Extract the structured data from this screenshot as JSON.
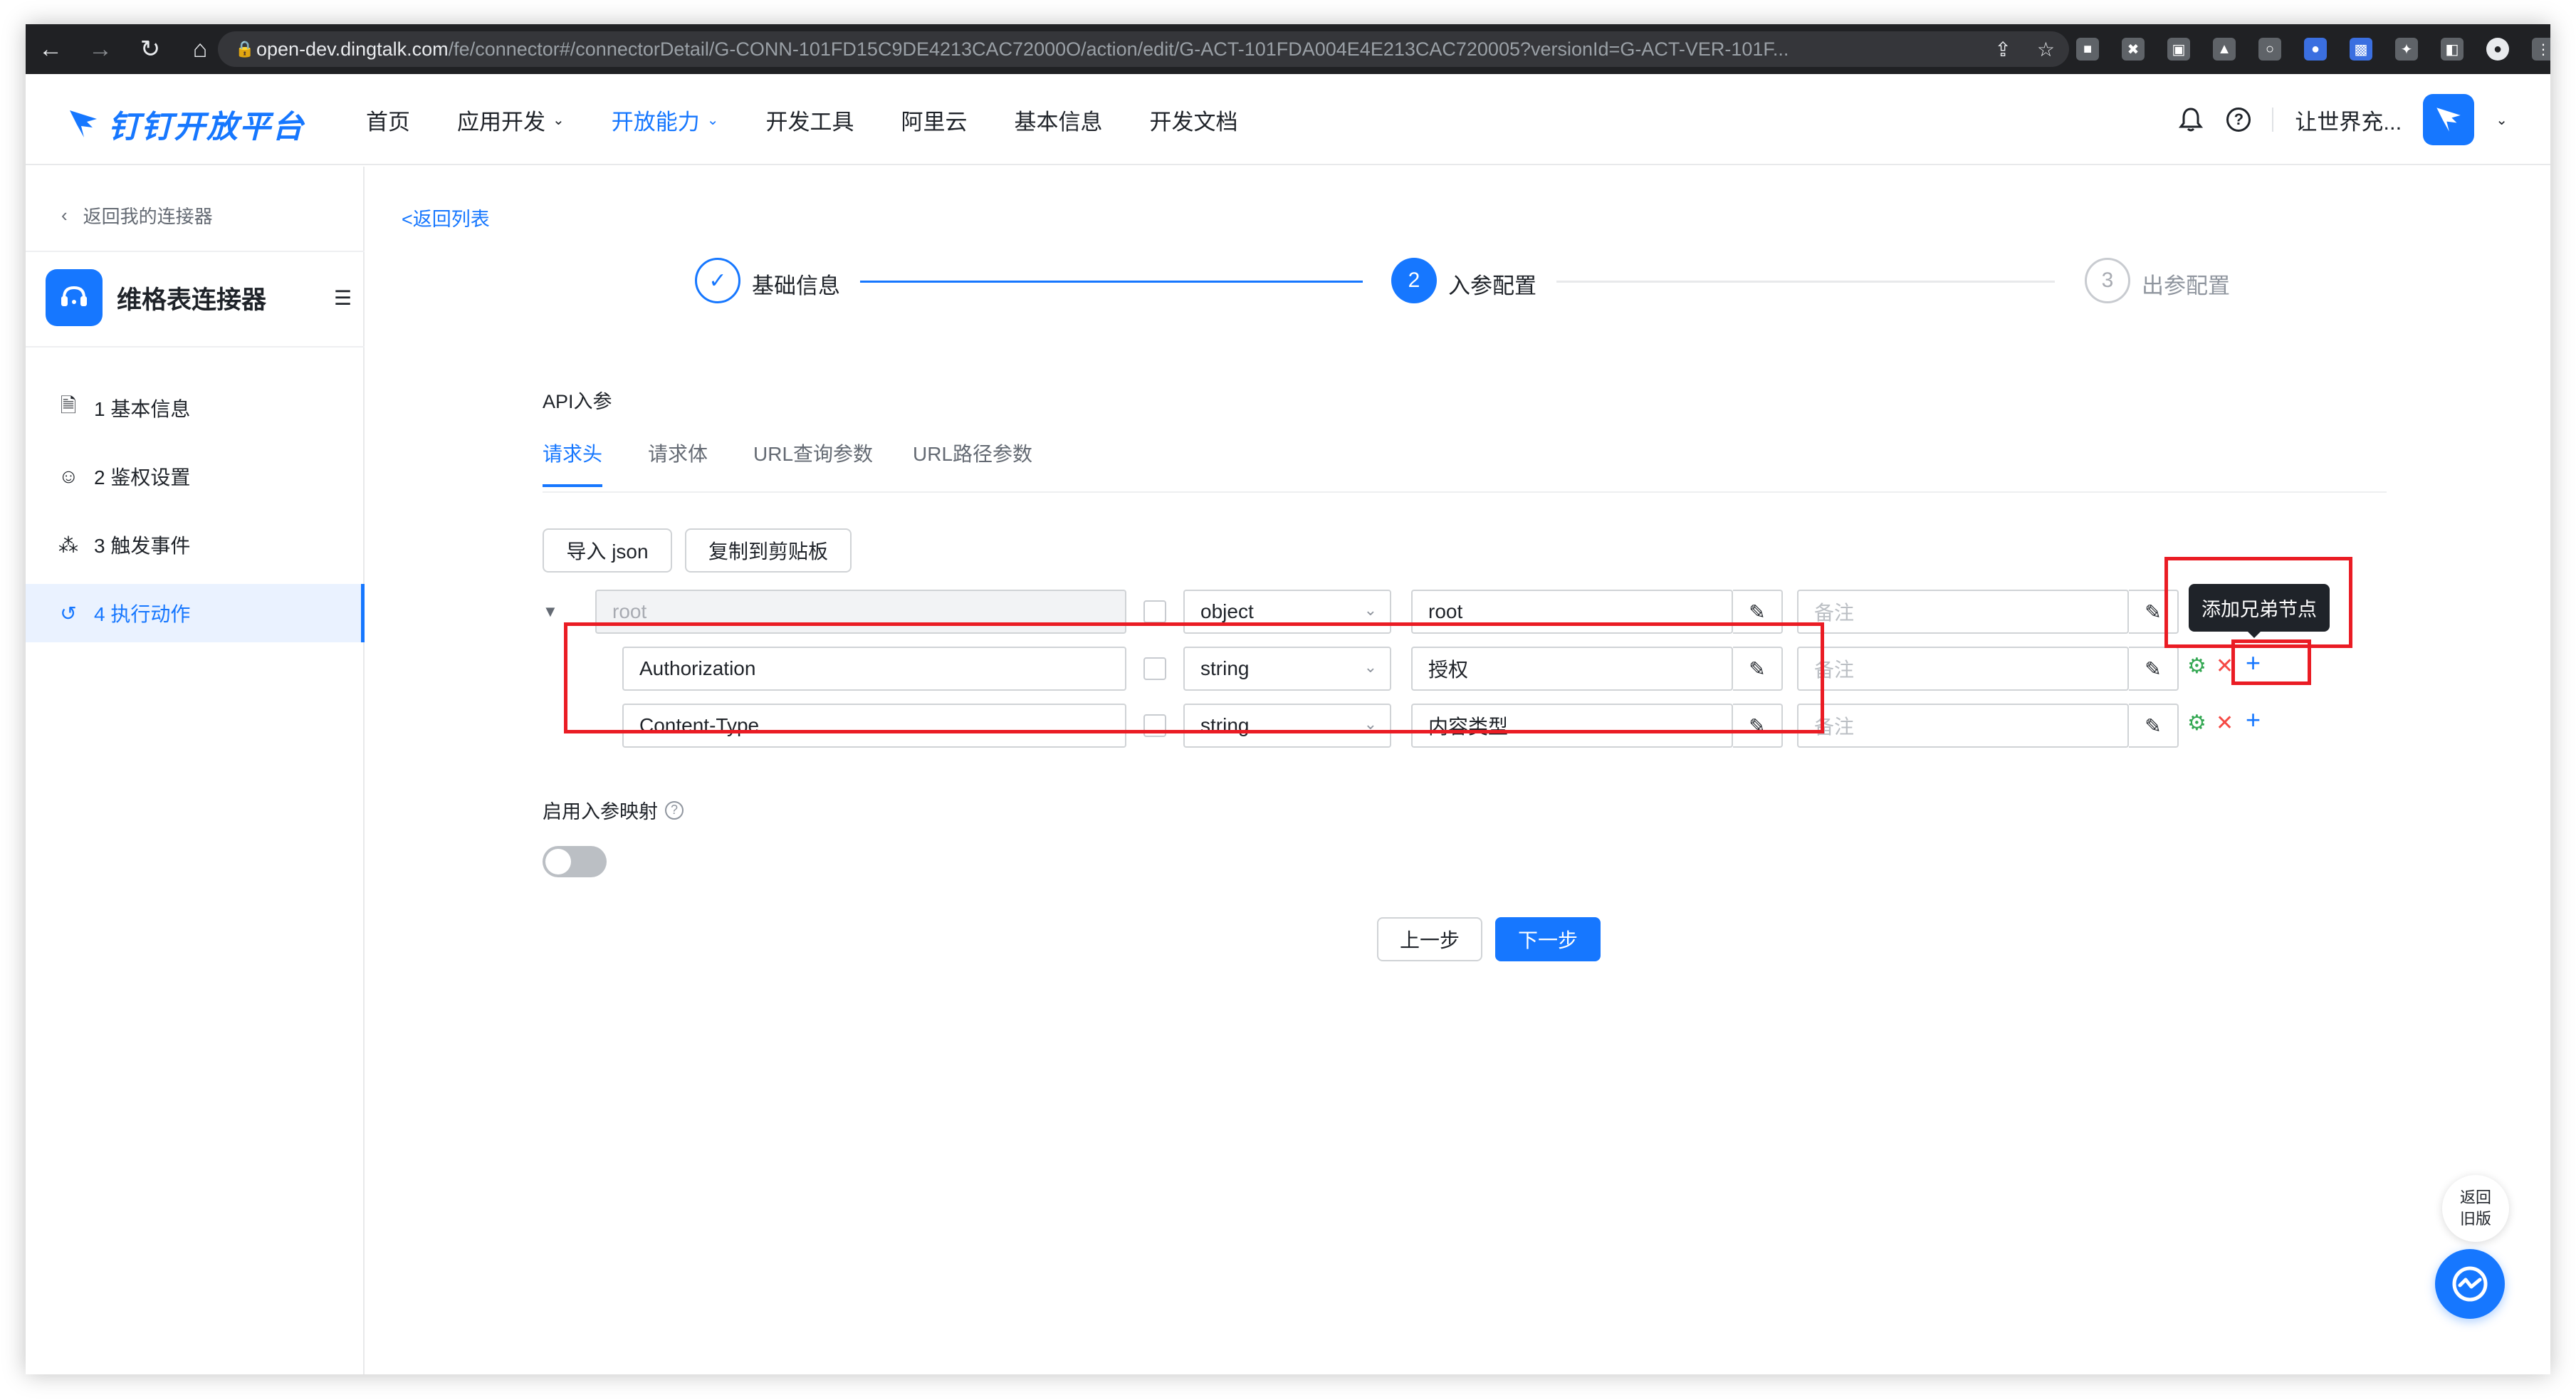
{
  "browser": {
    "url_host": "open-dev.dingtalk.com",
    "url_path": "/fe/connector#/connectorDetail/G-CONN-101FD15C9DE4213CAC72000O/action/edit/G-ACT-101FDA004E4E213CAC720005?versionId=G-ACT-VER-101F..."
  },
  "header": {
    "logo_text": "钉钉开放平台",
    "nav": [
      {
        "label": "首页"
      },
      {
        "label": "应用开发"
      },
      {
        "label": "开放能力"
      },
      {
        "label": "开发工具"
      },
      {
        "label": "阿里云"
      },
      {
        "label": "基本信息"
      },
      {
        "label": "开发文档"
      }
    ],
    "user_name": "让世界充..."
  },
  "sidebar": {
    "back_label": "返回我的连接器",
    "connector_name": "维格表连接器",
    "items": [
      {
        "label": "1 基本信息"
      },
      {
        "label": "2 鉴权设置"
      },
      {
        "label": "3 触发事件"
      },
      {
        "label": "4 执行动作"
      }
    ]
  },
  "main": {
    "back_list": "返回列表",
    "steps": [
      {
        "num": "",
        "label": "基础信息"
      },
      {
        "num": "2",
        "label": "入参配置"
      },
      {
        "num": "3",
        "label": "出参配置"
      }
    ],
    "section_title": "API入参",
    "tabs": [
      {
        "label": "请求头"
      },
      {
        "label": "请求体"
      },
      {
        "label": "URL查询参数"
      },
      {
        "label": "URL路径参数"
      }
    ],
    "import_json": "导入 json",
    "copy_clipboard": "复制到剪贴板",
    "tooltip": "添加兄弟节点",
    "rows": [
      {
        "name": "root",
        "type": "object",
        "desc": "root",
        "remark_placeholder": "备注"
      },
      {
        "name": "Authorization",
        "type": "string",
        "desc": "授权",
        "remark_placeholder": "备注"
      },
      {
        "name": "Content-Type",
        "type": "string",
        "desc": "内容类型",
        "remark_placeholder": "备注"
      }
    ],
    "mapping_label": "启用入参映射",
    "prev_button": "上一步",
    "next_button": "下一步",
    "float_back": "返回\n旧版"
  },
  "colors": {
    "brand": "#1677ff",
    "annotation": "#ea1c24"
  }
}
